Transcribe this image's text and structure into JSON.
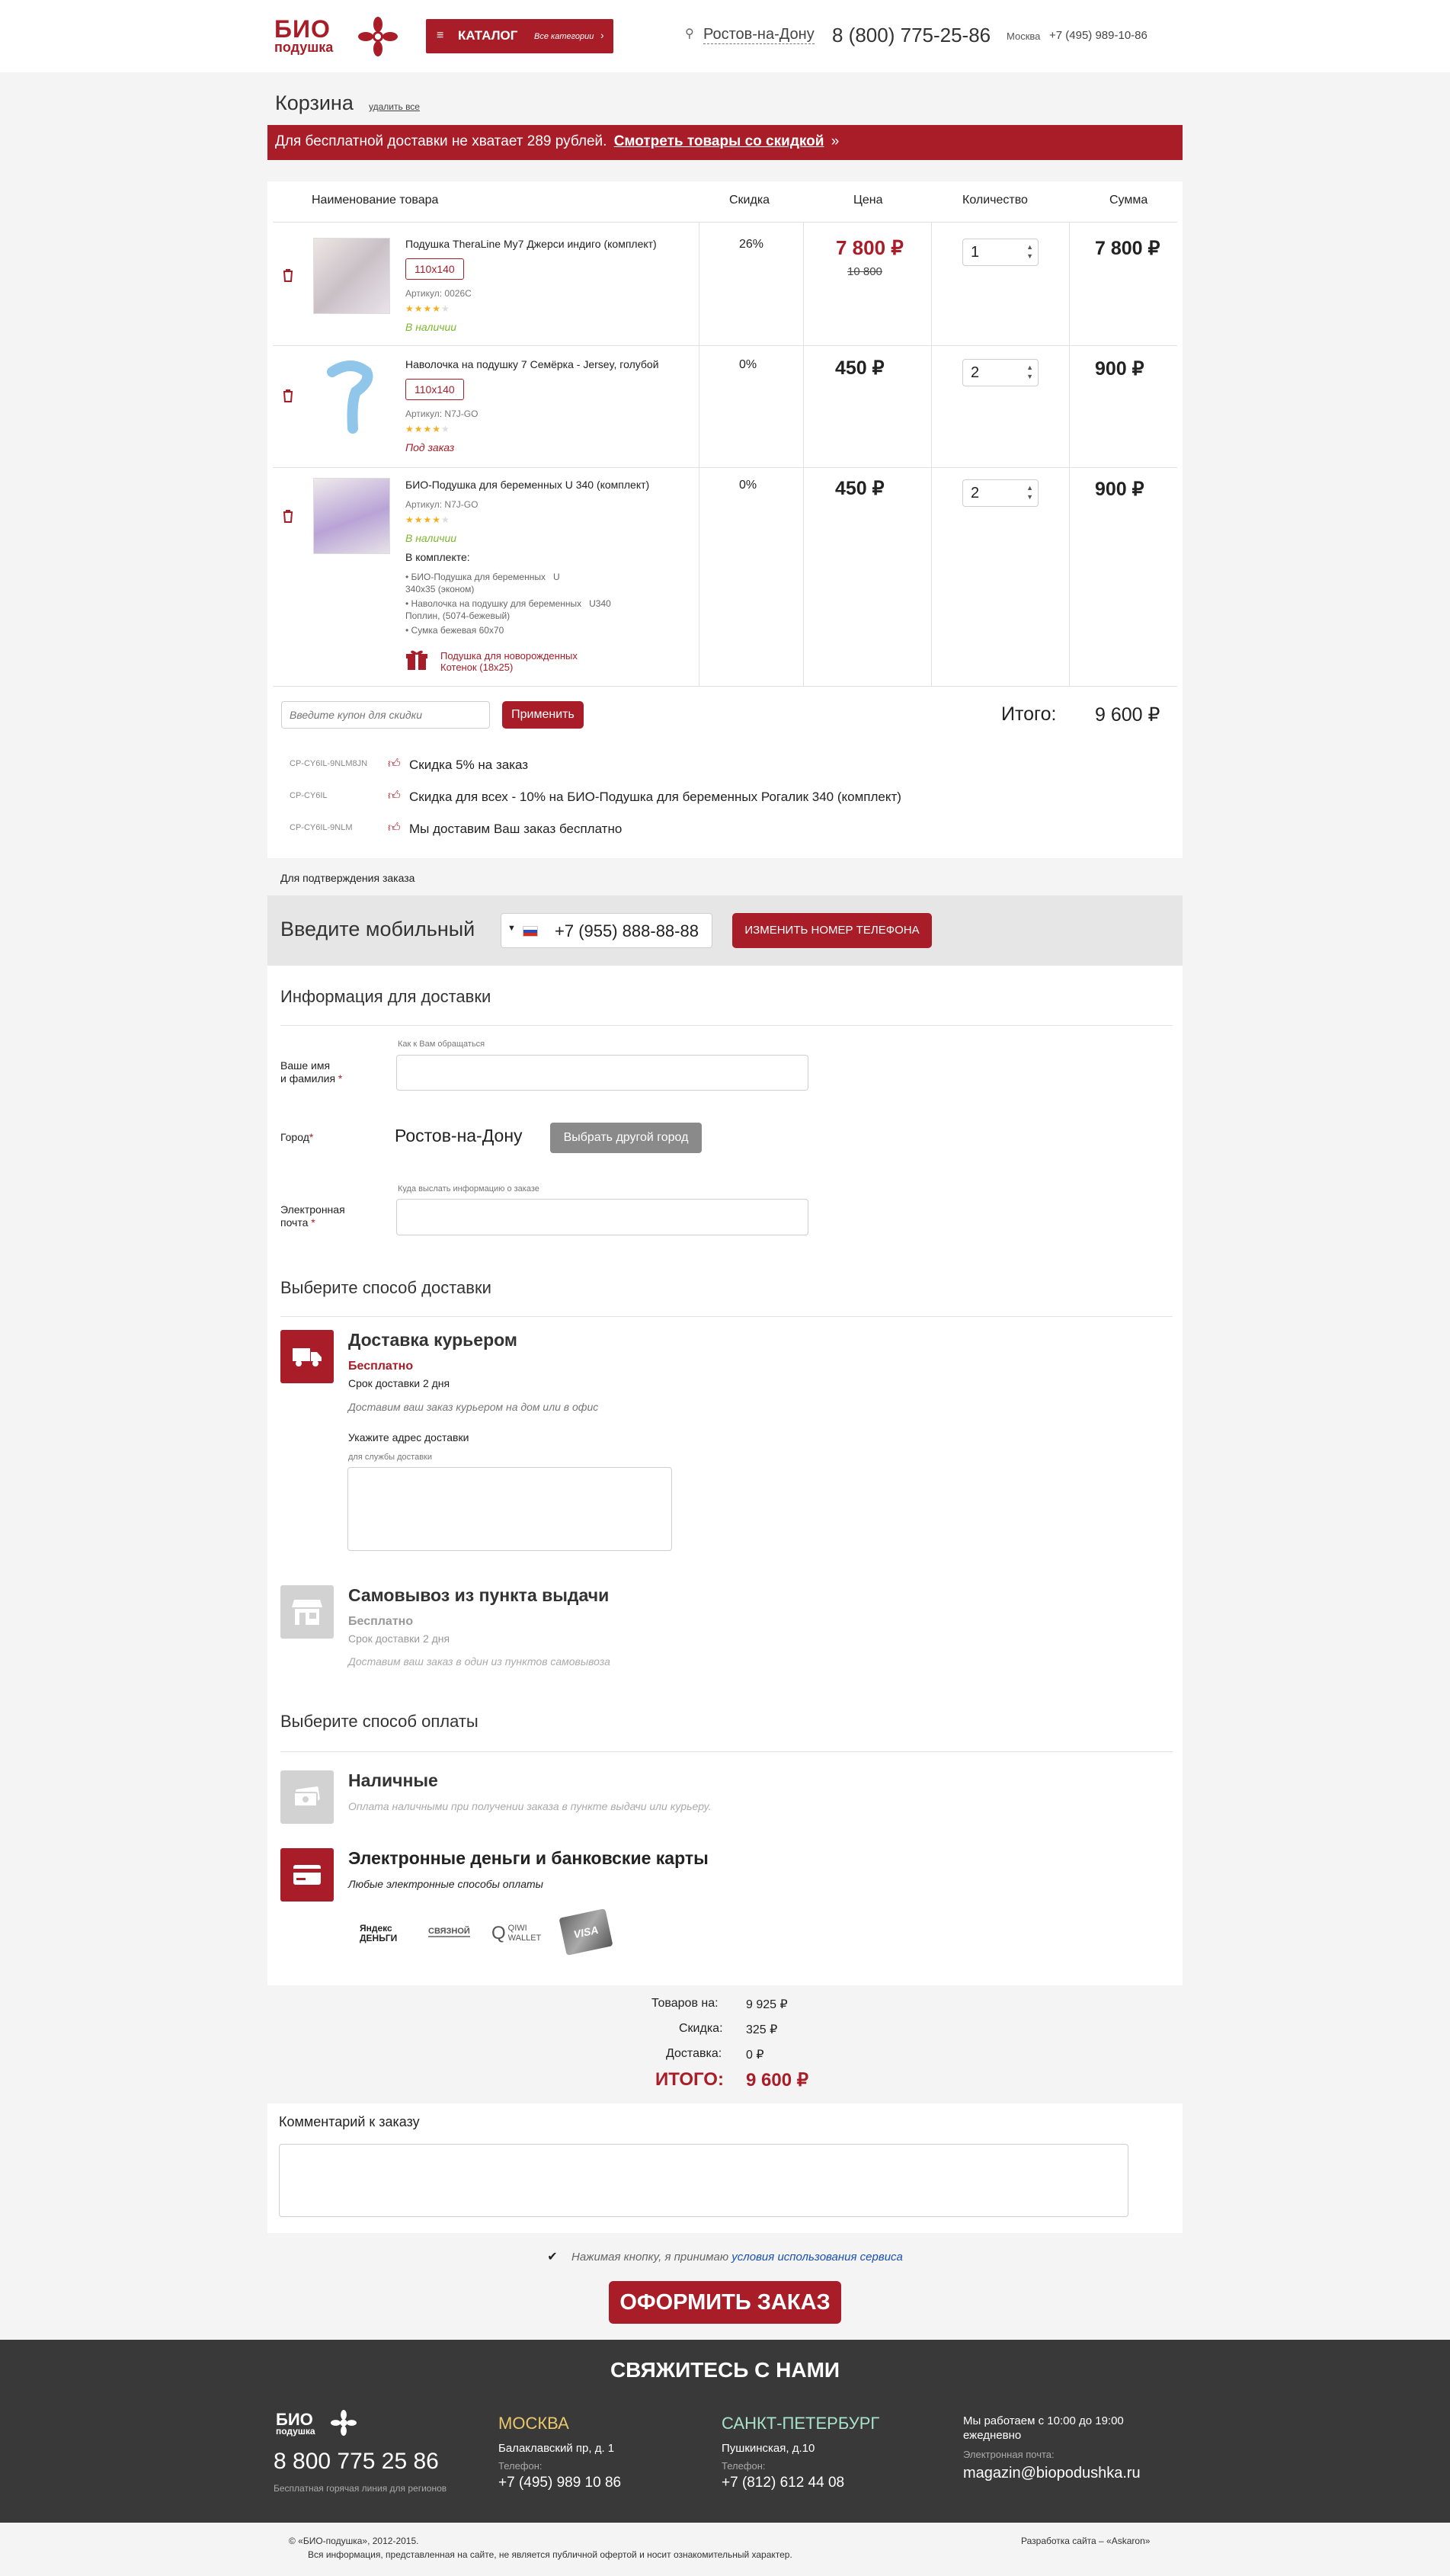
{
  "header": {
    "logo_top": "БИО",
    "logo_bottom": "подушка",
    "catalog_label": "КАТАЛОГ",
    "catalog_sub": "Все категории",
    "city": "Ростов-на-Дону",
    "phone": "8 (800) 775-25-86",
    "moscow_label": "Москва",
    "moscow_phone": "+7 (495) 989-10-86"
  },
  "cart": {
    "title": "Корзина",
    "clear_all": "удалить все",
    "banner_text": "Для бесплатной доставки не хватает 289 рублей.",
    "banner_link": "Смотреть товары со скидкой",
    "banner_arrow": "»",
    "columns": {
      "name": "Наименование товара",
      "discount": "Скидка",
      "price": "Цена",
      "qty": "Количество",
      "sum": "Сумма"
    },
    "items": [
      {
        "name": "Подушка TheraLine My7 Джерси индиго (комплект)",
        "size": "110x140",
        "sku_label": "Артикул:",
        "sku": "0026C",
        "rating": 4,
        "stock": "В наличии",
        "discount": "26%",
        "price": "7 800 ₽",
        "old_price": "10 800",
        "qty": "1",
        "sum": "7 800 ₽"
      },
      {
        "name": "Наволочка на подушку 7 Семёрка - Jersey, голубой",
        "size": "110x140",
        "sku_label": "Артикул:",
        "sku": "N7J-GO",
        "rating": 4,
        "stock": "Под заказ",
        "discount": "0%",
        "price": "450 ₽",
        "qty": "2",
        "sum": "900 ₽"
      },
      {
        "name": "БИО-Подушка для беременных U 340 (комплект)",
        "sku_label": "Артикул:",
        "sku": "N7J-GO",
        "rating": 4,
        "stock": "В наличии",
        "kit_label": "В комплекте:",
        "kit": [
          "• БИО-Подушка для беременных   U 340х35 (эконом)",
          "• Наволочка на подушку для беременных   U340 Поплин, (5074-бежевый)",
          "• Сумка бежевая 60х70"
        ],
        "gift": "Подушка для новорожденных Котенок (18х25)",
        "discount": "0%",
        "price": "450 ₽",
        "qty": "2",
        "sum": "900 ₽"
      }
    ],
    "coupon_placeholder": "Введите купон для скидки",
    "apply": "Применить",
    "total_label": "Итого:",
    "total": "9 600 ₽",
    "coupons": [
      {
        "code": "CP-CY6IL-9NLM8JN",
        "text": "Скидка 5% на заказ"
      },
      {
        "code": "CP-CY6IL",
        "text": "Скидка для всех - 10% на БИО-Подушка для беременных Рогалик 340 (комплект)"
      },
      {
        "code": "CP-CY6IL-9NLM",
        "text": "Мы доставим Ваш заказ бесплатно"
      }
    ]
  },
  "confirm": {
    "note": "Для подтверждения заказа",
    "mobile_label": "Введите мобильный",
    "phone": "+7 (955) 888-88-88",
    "change_btn": "ИЗМЕНИТЬ НОМЕР ТЕЛЕФОНА"
  },
  "delivery_info": {
    "title": "Информация для доставки",
    "name_hint": "Как к Вам обращаться",
    "name_label_1": "Ваше имя",
    "name_label_2": "и фамилия",
    "city_label": "Город",
    "city": "Ростов-на-Дону",
    "city_btn": "Выбрать другой город",
    "email_hint": "Куда выслать информацию о заказе",
    "email_label_1": "Электронная",
    "email_label_2": "почта",
    "req": "*"
  },
  "shipping": {
    "title": "Выберите способ доставки",
    "courier": {
      "title": "Доставка курьером",
      "price": "Бесплатно",
      "term": "Срок доставки 2 дня",
      "desc": "Доставим ваш заказ курьером на дом или в офис",
      "addr_label": "Укажите адрес доставки",
      "addr_hint": "для службы доставки"
    },
    "pickup": {
      "title": "Самовывоз из пункта выдачи",
      "price": "Бесплатно",
      "term": "Срок доставки 2 дня",
      "desc": "Доставим ваш заказ в один из пунктов самовывоза"
    }
  },
  "payment": {
    "title": "Выберите способ оплаты",
    "cash": {
      "title": "Наличные",
      "desc": "Оплата наличными при получении заказа в пункте выдачи или курьеру."
    },
    "emoney": {
      "title": "Электронные деньги и банковские карты",
      "desc": "Любые электронные способы оплаты",
      "logos": [
        "Яндекс ДЕНЬГИ",
        "СВЯЗНОЙ",
        "QIWI WALLET",
        "VISA"
      ]
    }
  },
  "summary": {
    "goods_label": "Товаров на:",
    "goods": "9 925 ₽",
    "discount_label": "Скидка:",
    "discount": "325 ₽",
    "delivery_label": "Доставка:",
    "delivery": "0 ₽",
    "total_label": "ИТОГО:",
    "total": "9 600 ₽"
  },
  "comment": {
    "title": "Комментарий к заказу"
  },
  "agree": {
    "text": "Нажимая кнопку, я принимаю",
    "link": "условия использования сервиса"
  },
  "submit": "ОФОРМИТЬ ЗАКАЗ",
  "footer": {
    "title": "СВЯЖИТЕСЬ С НАМИ",
    "phone": "8 800 775 25 86",
    "hotline": "Бесплатная горячая линия для регионов",
    "phone_label": "Телефон:",
    "moscow": {
      "city": "МОСКВА",
      "addr": "Балаклавский пр, д. 1",
      "phone": "+7 (495) 989 10 86"
    },
    "spb": {
      "city": "САНКТ-ПЕТЕРБУРГ",
      "addr": "Пушкинская, д.10",
      "phone": "+7 (812) 612 44 08"
    },
    "hours_1": "Мы работаем с 10:00 до 19:00",
    "hours_2": "ежедневно",
    "email_label": "Электронная почта:",
    "email": "magazin@biopodushka.ru",
    "copyright": "©  «БИО-подушка», 2012-2015.",
    "disclaimer": "Вся информация, представленная на сайте, не является публичной офертой и носит ознакомительный характер.",
    "dev": "Разработка сайта – «Askaron»"
  },
  "colors": {
    "brand_red": "#a81d27",
    "green": "#7cb82f",
    "footer_bg": "#393939",
    "moscow_gold": "#e8c86a",
    "spb_mint": "#a9e2cc"
  }
}
